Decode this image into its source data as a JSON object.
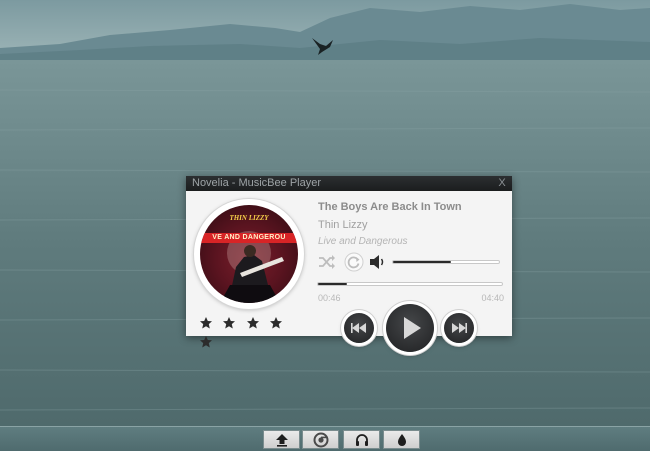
{
  "window": {
    "title": "Novelia - MusicBee Player",
    "close_label": "X"
  },
  "album_art": {
    "band_logo": "THIN LIZZY",
    "caption": "VE AND DANGEROU"
  },
  "now_playing": {
    "title": "The Boys Are Back In Town",
    "artist": "Thin Lizzy",
    "album": "Live and Dangerous",
    "elapsed": "00:46",
    "total": "04:40",
    "progress_fraction": 0.16,
    "volume_fraction": 0.55,
    "rating_stars": 5
  },
  "controls": {
    "shuffle_icon": "shuffle-icon",
    "repeat_icon": "repeat-icon",
    "volume_icon": "speaker-icon",
    "prev_icon": "skip-previous-icon",
    "play_icon": "play-icon",
    "next_icon": "skip-next-icon"
  },
  "taskbar": {
    "items": [
      {
        "icon": "upload-arrow-icon"
      },
      {
        "icon": "chrome-icon"
      },
      {
        "icon": "headphones-icon"
      },
      {
        "icon": "water-drop-icon"
      }
    ]
  },
  "colors": {
    "titlebar": "#1f2224",
    "panel": "#f4f4f4",
    "fill": "#2a2a2a",
    "button_dark": "#2a2b2d"
  }
}
